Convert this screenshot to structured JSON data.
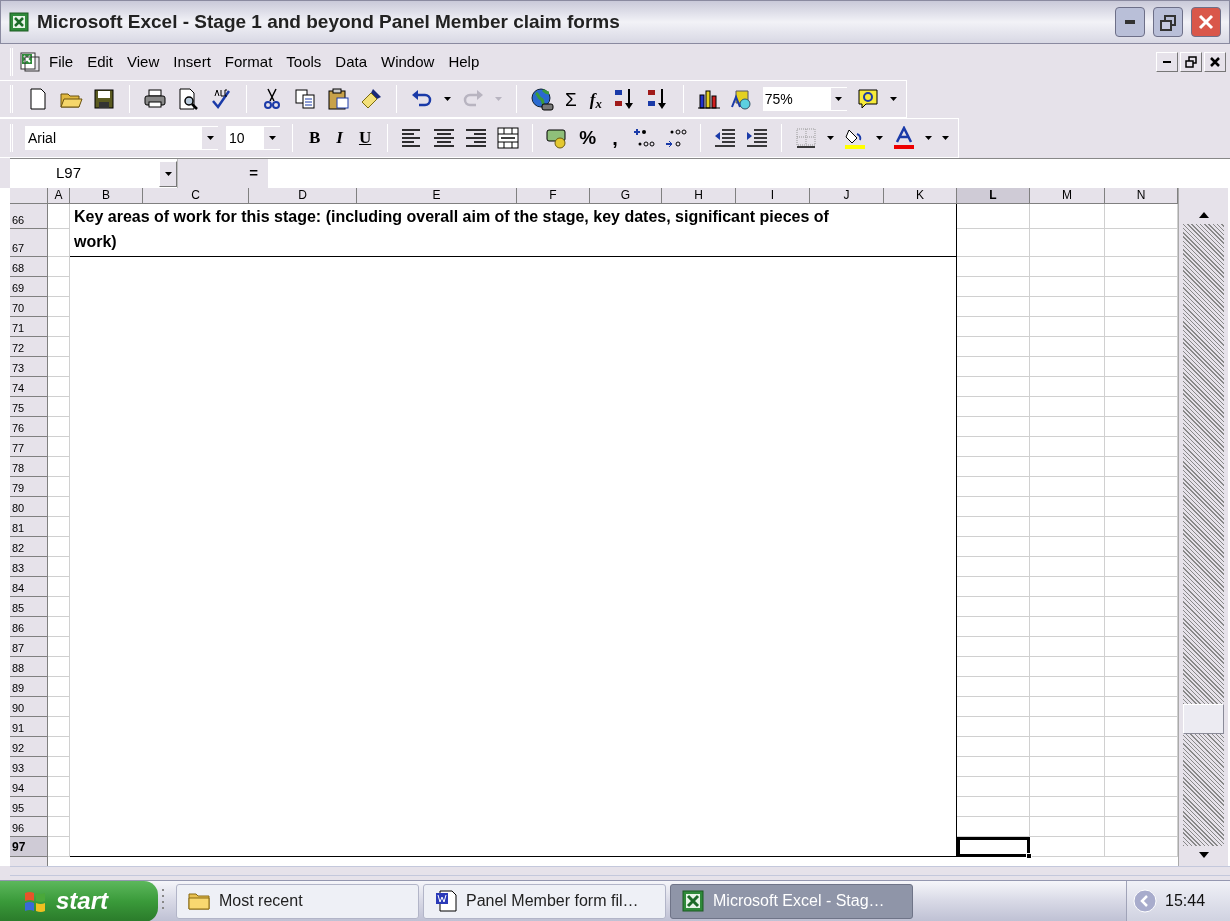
{
  "window": {
    "title": "Microsoft Excel - Stage 1 and beyond Panel Member claim forms"
  },
  "menu": [
    "File",
    "Edit",
    "View",
    "Insert",
    "Format",
    "Tools",
    "Data",
    "Window",
    "Help"
  ],
  "standard_toolbar": {
    "sum": "Σ",
    "function": "f$_{x}$",
    "zoom": "75%"
  },
  "formatting_toolbar": {
    "font": "Arial",
    "size": "10",
    "bold": "B",
    "italic": "I",
    "underline": "U",
    "percent": "%",
    "comma": ","
  },
  "formula_bar": {
    "name_box": "L97",
    "equals": "="
  },
  "columns": [
    {
      "label": "A",
      "selected": false
    },
    {
      "label": "B",
      "selected": false
    },
    {
      "label": "C",
      "selected": false
    },
    {
      "label": "D",
      "selected": false
    },
    {
      "label": "E",
      "selected": false
    },
    {
      "label": "F",
      "selected": false
    },
    {
      "label": "G",
      "selected": false
    },
    {
      "label": "H",
      "selected": false
    },
    {
      "label": "I",
      "selected": false
    },
    {
      "label": "J",
      "selected": false
    },
    {
      "label": "K",
      "selected": false
    },
    {
      "label": "L",
      "selected": true
    },
    {
      "label": "M",
      "selected": false
    },
    {
      "label": "N",
      "selected": false
    }
  ],
  "rows": [
    {
      "label": "66",
      "selected": false
    },
    {
      "label": "67",
      "selected": false
    },
    {
      "label": "68",
      "selected": false
    },
    {
      "label": "69",
      "selected": false
    },
    {
      "label": "70",
      "selected": false
    },
    {
      "label": "71",
      "selected": false
    },
    {
      "label": "72",
      "selected": false
    },
    {
      "label": "73",
      "selected": false
    },
    {
      "label": "74",
      "selected": false
    },
    {
      "label": "75",
      "selected": false
    },
    {
      "label": "76",
      "selected": false
    },
    {
      "label": "77",
      "selected": false
    },
    {
      "label": "78",
      "selected": false
    },
    {
      "label": "79",
      "selected": false
    },
    {
      "label": "80",
      "selected": false
    },
    {
      "label": "81",
      "selected": false
    },
    {
      "label": "82",
      "selected": false
    },
    {
      "label": "83",
      "selected": false
    },
    {
      "label": "84",
      "selected": false
    },
    {
      "label": "85",
      "selected": false
    },
    {
      "label": "86",
      "selected": false
    },
    {
      "label": "87",
      "selected": false
    },
    {
      "label": "88",
      "selected": false
    },
    {
      "label": "89",
      "selected": false
    },
    {
      "label": "90",
      "selected": false
    },
    {
      "label": "91",
      "selected": false
    },
    {
      "label": "92",
      "selected": false
    },
    {
      "label": "93",
      "selected": false
    },
    {
      "label": "94",
      "selected": false
    },
    {
      "label": "95",
      "selected": false
    },
    {
      "label": "96",
      "selected": false
    },
    {
      "label": "97",
      "selected": true
    }
  ],
  "heading_cell": {
    "text": "Key areas of work for this stage: (including overall aim of the stage, key dates, significant pieces of work)"
  },
  "taskbar": {
    "start": "start",
    "tasks": [
      {
        "kind": "folder",
        "label": "Most recent",
        "selected": false
      },
      {
        "kind": "word",
        "label": "Panel Member form fil…",
        "selected": false
      },
      {
        "kind": "excel",
        "label": "Microsoft Excel - Stag…",
        "selected": true
      }
    ],
    "clock": "15:44"
  }
}
